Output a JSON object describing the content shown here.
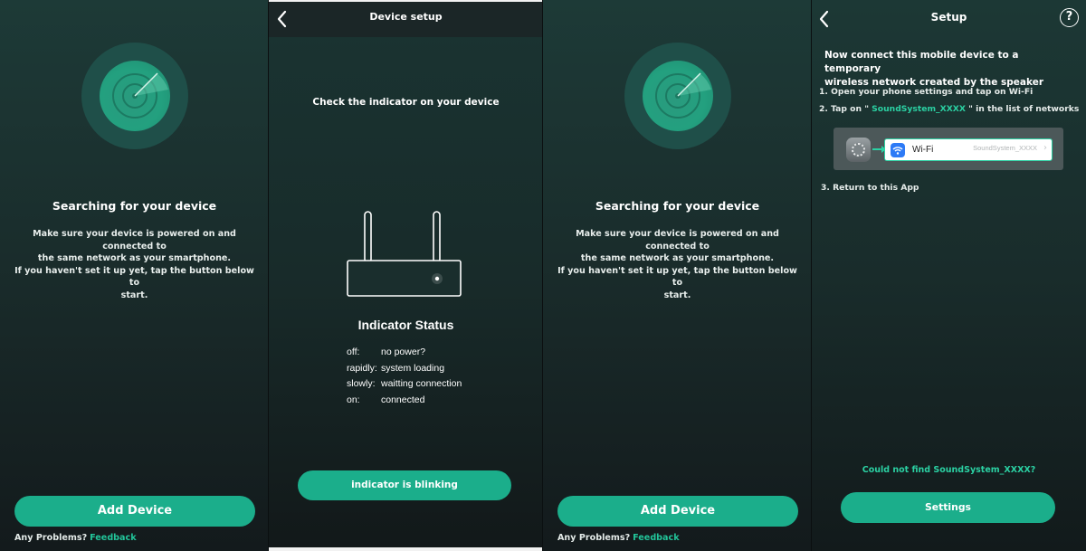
{
  "colors": {
    "accent": "#1bae8b",
    "accent_text": "#2bd1a3",
    "link": "#22c59a"
  },
  "search_screen": {
    "title": "Searching for your device",
    "desc_lines": [
      "Make sure your device is powered on and connected to",
      "the same network as your smartphone.",
      "If you haven't set it up yet, tap the button below to",
      "start."
    ],
    "add_button": "Add Device",
    "problems_label": "Any Problems?",
    "feedback_link": "Feedback",
    "icon": "radar-icon"
  },
  "device_setup": {
    "header": "Device setup",
    "back_icon": "back-arrow-icon",
    "check_text": "Check the indicator on your device",
    "router_icon": "router-icon",
    "indicator_title": "Indicator Status",
    "statuses": [
      {
        "key": "off:",
        "value": "no power?"
      },
      {
        "key": "rapidly:",
        "value": "system loading"
      },
      {
        "key": "slowly:",
        "value": "waitting connection"
      },
      {
        "key": "on:",
        "value": "connected"
      }
    ],
    "button": "indicator is blinking"
  },
  "setup": {
    "header": "Setup",
    "help_icon": "?",
    "connect_title_lines": [
      "Now connect this mobile device to a temporary",
      "wireless network created by the speaker"
    ],
    "step1": "1. Open your phone settings and tap on Wi-Fi",
    "step2_pre": "2. Tap on \"",
    "step2_ssid": " SoundSystem_XXXX ",
    "step2_post": "\" in the list of networks",
    "wifi_label": "Wi-Fi",
    "wifi_ssid": "SoundSystem_XXXX",
    "wifi_chevron": "›",
    "step3": "3. Return to this App",
    "not_found": "Could not find SoundSystem_XXXX?",
    "settings_button": "Settings"
  }
}
